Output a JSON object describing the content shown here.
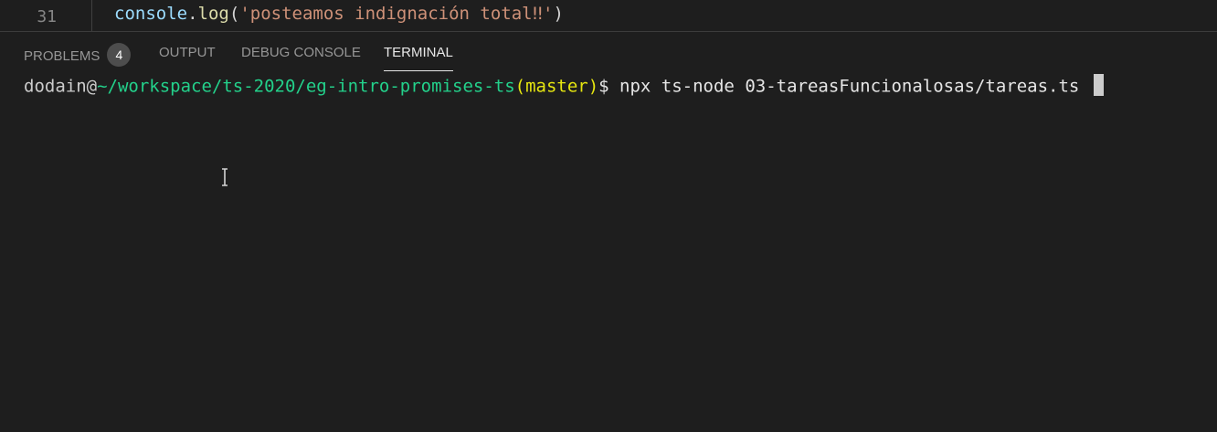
{
  "editor": {
    "line_number": "31",
    "code": {
      "object": "console",
      "dot": ".",
      "method": "log",
      "open": "(",
      "string": "'posteamos indignación total‼'",
      "close": ")"
    }
  },
  "panel": {
    "tabs": [
      {
        "label": "PROBLEMS",
        "badge": "4"
      },
      {
        "label": "OUTPUT"
      },
      {
        "label": "DEBUG CONSOLE"
      },
      {
        "label": "TERMINAL"
      }
    ],
    "active_tab": "TERMINAL"
  },
  "terminal": {
    "user": "dodain@",
    "path": "~/workspace/ts-2020/eg-intro-promises-ts",
    "branch": "(master)",
    "prompt": "$ ",
    "command": "npx ts-node 03-tareasFuncionalosas/tareas.ts "
  },
  "colors": {
    "background": "#1e1e1e",
    "path": "#23d18b",
    "branch": "#e5e510",
    "string": "#ce9178",
    "function": "#dcdcaa",
    "object": "#9cdcfe"
  },
  "icons": {
    "mouse_cursor": "text-ibeam-cursor-icon"
  }
}
